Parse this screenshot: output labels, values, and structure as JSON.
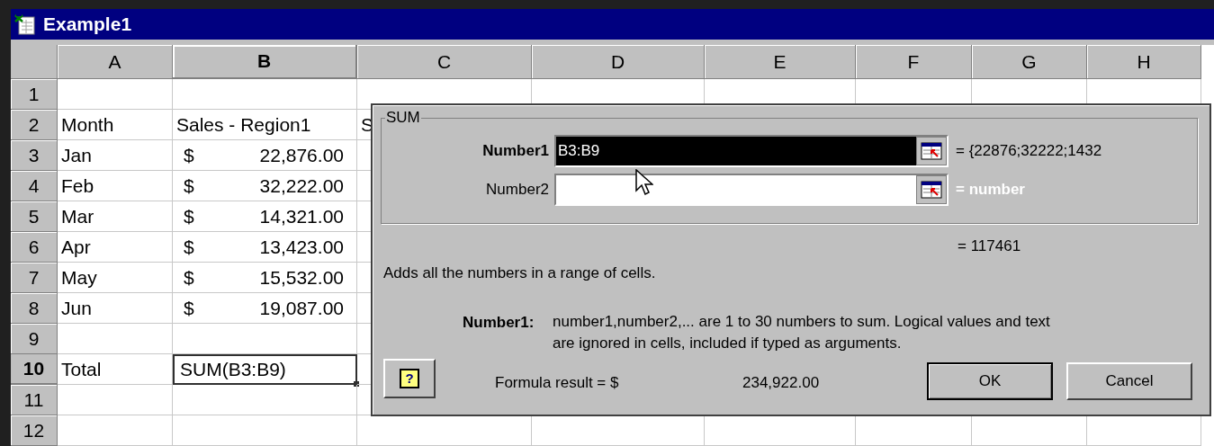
{
  "window": {
    "title": "Example1"
  },
  "columns": [
    {
      "label": "A",
      "selected": false
    },
    {
      "label": "B",
      "selected": true
    },
    {
      "label": "C",
      "selected": false
    },
    {
      "label": "D",
      "selected": false
    },
    {
      "label": "E",
      "selected": false
    },
    {
      "label": "F",
      "selected": false
    },
    {
      "label": "G",
      "selected": false
    },
    {
      "label": "H",
      "selected": false
    }
  ],
  "rows": [
    {
      "label": "1",
      "selected": false,
      "cells": []
    },
    {
      "label": "2",
      "selected": false,
      "cells": [
        {
          "kind": "text",
          "text": "Month"
        },
        {
          "kind": "text",
          "text": "Sales - Region1"
        },
        {
          "kind": "text",
          "text": "S"
        }
      ]
    },
    {
      "label": "3",
      "selected": false,
      "cells": [
        {
          "kind": "text",
          "text": "Jan"
        },
        {
          "kind": "currency",
          "symbol": "$",
          "amount": "22,876.00"
        }
      ]
    },
    {
      "label": "4",
      "selected": false,
      "cells": [
        {
          "kind": "text",
          "text": "Feb"
        },
        {
          "kind": "currency",
          "symbol": "$",
          "amount": "32,222.00"
        }
      ]
    },
    {
      "label": "5",
      "selected": false,
      "cells": [
        {
          "kind": "text",
          "text": "Mar"
        },
        {
          "kind": "currency",
          "symbol": "$",
          "amount": "14,321.00"
        }
      ]
    },
    {
      "label": "6",
      "selected": false,
      "cells": [
        {
          "kind": "text",
          "text": "Apr"
        },
        {
          "kind": "currency",
          "symbol": "$",
          "amount": "13,423.00"
        }
      ]
    },
    {
      "label": "7",
      "selected": false,
      "cells": [
        {
          "kind": "text",
          "text": "May"
        },
        {
          "kind": "currency",
          "symbol": "$",
          "amount": "15,532.00"
        }
      ]
    },
    {
      "label": "8",
      "selected": false,
      "cells": [
        {
          "kind": "text",
          "text": "Jun"
        },
        {
          "kind": "currency",
          "symbol": "$",
          "amount": "19,087.00"
        }
      ]
    },
    {
      "label": "9",
      "selected": false,
      "cells": []
    },
    {
      "label": "10",
      "selected": true,
      "cells": [
        {
          "kind": "text",
          "text": "Total"
        },
        {
          "kind": "formula",
          "text": "SUM(B3:B9)",
          "selected": true
        }
      ]
    },
    {
      "label": "11",
      "selected": false,
      "cells": []
    },
    {
      "label": "12",
      "selected": false,
      "cells": []
    }
  ],
  "dialog": {
    "group_title": "SUM",
    "arguments": [
      {
        "label": "Number1",
        "value": "B3:B9",
        "selected": true,
        "result": "= {22876;32222;1432",
        "dimmed": false
      },
      {
        "label": "Number2",
        "selected": false,
        "result": "= number",
        "dimmed": true
      }
    ],
    "total": "= 117461",
    "description": "Adds all the numbers in a range of cells.",
    "argument_help_label": "Number1:",
    "argument_help_lines": [
      "number1,number2,... are 1 to 30 numbers to sum. Logical values and text",
      "are ignored in cells, included if typed as arguments."
    ],
    "help_button": "?",
    "formula_result_label": "Formula result = $",
    "formula_result_value": "234,922.00",
    "buttons": [
      "OK",
      "Cancel"
    ]
  }
}
